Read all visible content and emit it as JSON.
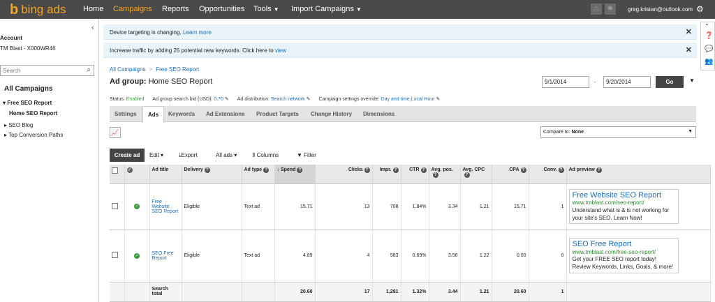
{
  "nav": {
    "logo_text": "bing ads",
    "items": [
      "Home",
      "Campaigns",
      "Reports",
      "Opportunities",
      "Tools",
      "Import Campaigns"
    ],
    "user_email": "greg.kristan@outlook.com",
    "accent_color": "#f5a623"
  },
  "sidebar": {
    "account_label": "Account",
    "account_name": "TM Blast - X000WR46",
    "search_placeholder": "Search",
    "all_campaigns": "All Campaigns",
    "tree": {
      "campaign": "Free SEO Report",
      "ad_group": "Home SEO Report",
      "others": [
        "SEO Blog",
        "Top Conversion Paths"
      ]
    }
  },
  "banners": [
    {
      "text": "Device targeting is changing. ",
      "link": "Learn more"
    },
    {
      "text": "Increase traffic by adding 25 potential new keywords. Click here to ",
      "link": "view"
    }
  ],
  "breadcrumb": {
    "root": "All Campaigns",
    "sep": ">",
    "current": "Free SEO Report"
  },
  "title": {
    "label": "Ad group:",
    "name": "Home SEO Report"
  },
  "status": {
    "status_label": "Status:",
    "status_value": "Enabled",
    "bid_label": "Ad group search bid (USD):",
    "bid_value": "0.70",
    "distribution_label": "Ad distribution:",
    "distribution_value": "Search network",
    "override_label": "Campaign settings override:",
    "override_value": "Day and time,Local Hour"
  },
  "date_range": {
    "start": "9/1/2014",
    "dash": "-",
    "end": "9/20/2014",
    "go": "Go"
  },
  "tabs": [
    "Settings",
    "Ads",
    "Keywords",
    "Ad Extensions",
    "Product Targets",
    "Change History",
    "Dimensions"
  ],
  "compare": {
    "label": "Compare to:",
    "value": "None"
  },
  "toolbar": {
    "create": "Create ad",
    "edit": "Edit",
    "export": "Export",
    "all_ads": "All ads",
    "columns": "Columns",
    "filter": "Filter"
  },
  "table": {
    "headers": [
      "Ad title",
      "Delivery",
      "Ad type",
      "Spend",
      "Clicks",
      "Impr.",
      "CTR",
      "Avg. pos.",
      "Avg. CPC",
      "CPA",
      "Conv.",
      "Ad preview"
    ],
    "rows": [
      {
        "title": "Free Website SEO Report",
        "delivery": "Eligible",
        "type": "Text ad",
        "spend": "15.71",
        "clicks": "13",
        "impr": "708",
        "ctr": "1.84%",
        "avgpos": "3.34",
        "avgcpc": "1.21",
        "cpa": "15.71",
        "conv": "1",
        "preview": {
          "title": "Free Website SEO Report",
          "url": "www.tmblast.com/seo-report/",
          "desc": "Understand what is & is not working for your site's SEO. Learn Now!"
        }
      },
      {
        "title": "SEO Free Report",
        "delivery": "Eligible",
        "type": "Text ad",
        "spend": "4.89",
        "clicks": "4",
        "impr": "583",
        "ctr": "0.69%",
        "avgpos": "3.56",
        "avgcpc": "1.22",
        "cpa": "0.00",
        "conv": "0",
        "preview": {
          "title": "SEO Free Report",
          "url": "www.tmblast.com/free-seo-report/",
          "desc": "Get your FREE SEO report today! Review Keywords, Links, Goals, & more!"
        }
      }
    ],
    "total": {
      "label": "Search total",
      "spend": "20.60",
      "clicks": "17",
      "impr": "1,291",
      "ctr": "1.32%",
      "avgpos": "3.44",
      "avgcpc": "1.21",
      "cpa": "20.60",
      "conv": "1"
    }
  }
}
